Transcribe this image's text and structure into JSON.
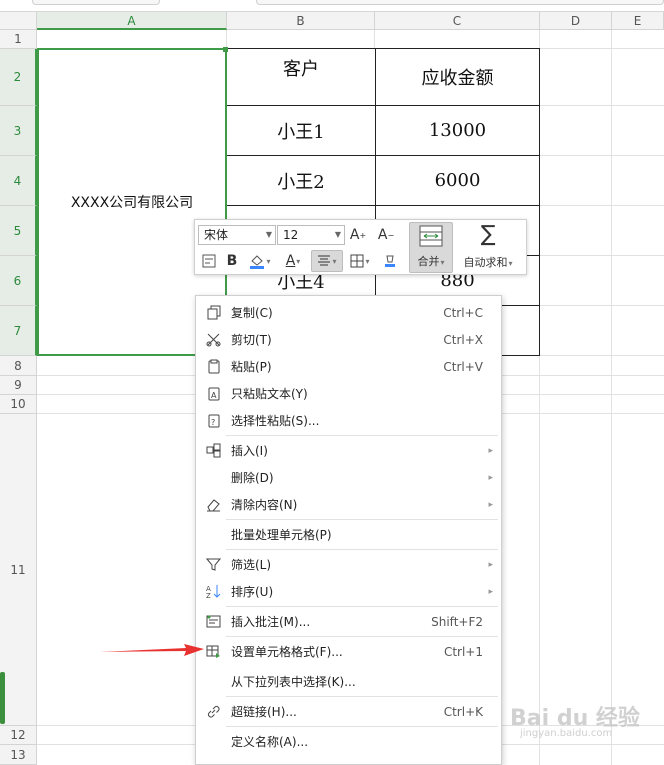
{
  "columns": [
    "A",
    "B",
    "C",
    "D",
    "E"
  ],
  "rows": [
    "1",
    "2",
    "3",
    "4",
    "5",
    "6",
    "7",
    "8",
    "9",
    "10",
    "11",
    "12",
    "13"
  ],
  "merged_cell": "XXXX公司有限公司",
  "table": {
    "header": [
      "客户",
      "应收金额"
    ],
    "rows": [
      [
        "小王1",
        "13000"
      ],
      [
        "小王2",
        "6000"
      ],
      [
        "",
        ""
      ],
      [
        "小王4",
        "880"
      ],
      [
        "",
        ""
      ]
    ]
  },
  "mini_toolbar": {
    "font_name": "宋体",
    "font_size": "12",
    "merge_label": "合并",
    "autosum_label": "自动求和"
  },
  "context_menu": {
    "items": [
      {
        "label": "复制(C)",
        "shortcut": "Ctrl+C",
        "icon": "copy-icon"
      },
      {
        "label": "剪切(T)",
        "shortcut": "Ctrl+X",
        "icon": "scissors-icon"
      },
      {
        "label": "粘贴(P)",
        "shortcut": "Ctrl+V",
        "icon": "paste-icon"
      },
      {
        "label": "只粘贴文本(Y)",
        "shortcut": "",
        "icon": "paste-text-icon"
      },
      {
        "label": "选择性粘贴(S)...",
        "shortcut": "",
        "icon": "paste-special-icon"
      },
      {
        "label": "插入(I)",
        "shortcut": "",
        "icon": "insert-cells-icon"
      },
      {
        "label": "删除(D)",
        "shortcut": "",
        "icon": ""
      },
      {
        "label": "清除内容(N)",
        "shortcut": "",
        "icon": "eraser-icon"
      },
      {
        "label": "批量处理单元格(P)",
        "shortcut": "",
        "icon": ""
      },
      {
        "label": "筛选(L)",
        "shortcut": "",
        "icon": "filter-icon"
      },
      {
        "label": "排序(U)",
        "shortcut": "",
        "icon": "sort-icon"
      },
      {
        "label": "插入批注(M)...",
        "shortcut": "Shift+F2",
        "icon": "comment-icon"
      },
      {
        "label": "设置单元格格式(F)...",
        "shortcut": "Ctrl+1",
        "icon": "format-cells-icon"
      },
      {
        "label": "从下拉列表中选择(K)...",
        "shortcut": "",
        "icon": ""
      },
      {
        "label": "超链接(H)...",
        "shortcut": "Ctrl+K",
        "icon": "link-icon"
      },
      {
        "label": "定义名称(A)...",
        "shortcut": "",
        "icon": ""
      }
    ]
  },
  "watermark": {
    "brand": "Bai du 经验",
    "sub": "jingyan.baidu.com"
  },
  "colors": {
    "selection": "#3f9b48",
    "annotation_arrow": "#e8322f"
  }
}
